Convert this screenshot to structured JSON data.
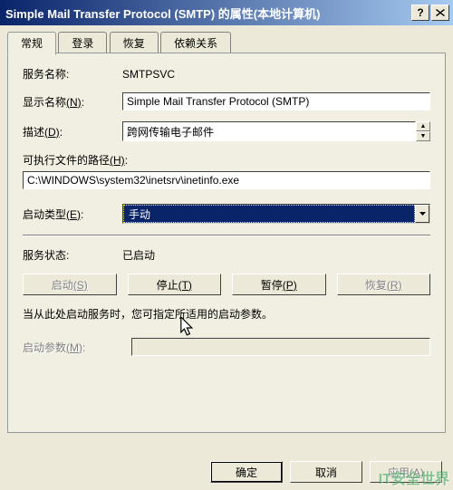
{
  "title": "Simple Mail Transfer Protocol (SMTP) 的属性(本地计算机)",
  "tabs": {
    "general": "常规",
    "logon": "登录",
    "recovery": "恢复",
    "dependencies": "依赖关系"
  },
  "labels": {
    "service_name": "服务名称:",
    "display_name_pre": "显示名称",
    "display_name_key": "(N)",
    "display_name_post": ":",
    "description_pre": "描述",
    "description_key": "(D)",
    "description_post": ":",
    "exe_path_pre": "可执行文件的路径",
    "exe_path_key": "(H)",
    "exe_path_post": ":",
    "startup_type_pre": "启动类型",
    "startup_type_key": "(E)",
    "startup_type_post": ":",
    "status": "服务状态:",
    "start_pre": "启动",
    "start_key": "(S)",
    "stop_pre": "停止",
    "stop_key": "(T)",
    "pause_pre": "暂停",
    "pause_key": "(P)",
    "resume_pre": "恢复",
    "resume_key": "(R)",
    "hint": "当从此处启动服务时，您可指定所适用的启动参数。",
    "params_pre": "启动参数",
    "params_key": "(M)",
    "params_post": ":",
    "ok": "确定",
    "cancel": "取消",
    "apply_pre": "应用",
    "apply_key": "(A)"
  },
  "values": {
    "service_name": "SMTPSVC",
    "display_name": "Simple Mail Transfer Protocol (SMTP)",
    "description": "跨网传输电子邮件",
    "exe_path": "C:\\WINDOWS\\system32\\inetsrv\\inetinfo.exe",
    "startup_type": "手动",
    "status": "已启动",
    "params": ""
  },
  "watermark": "IT安全世界"
}
